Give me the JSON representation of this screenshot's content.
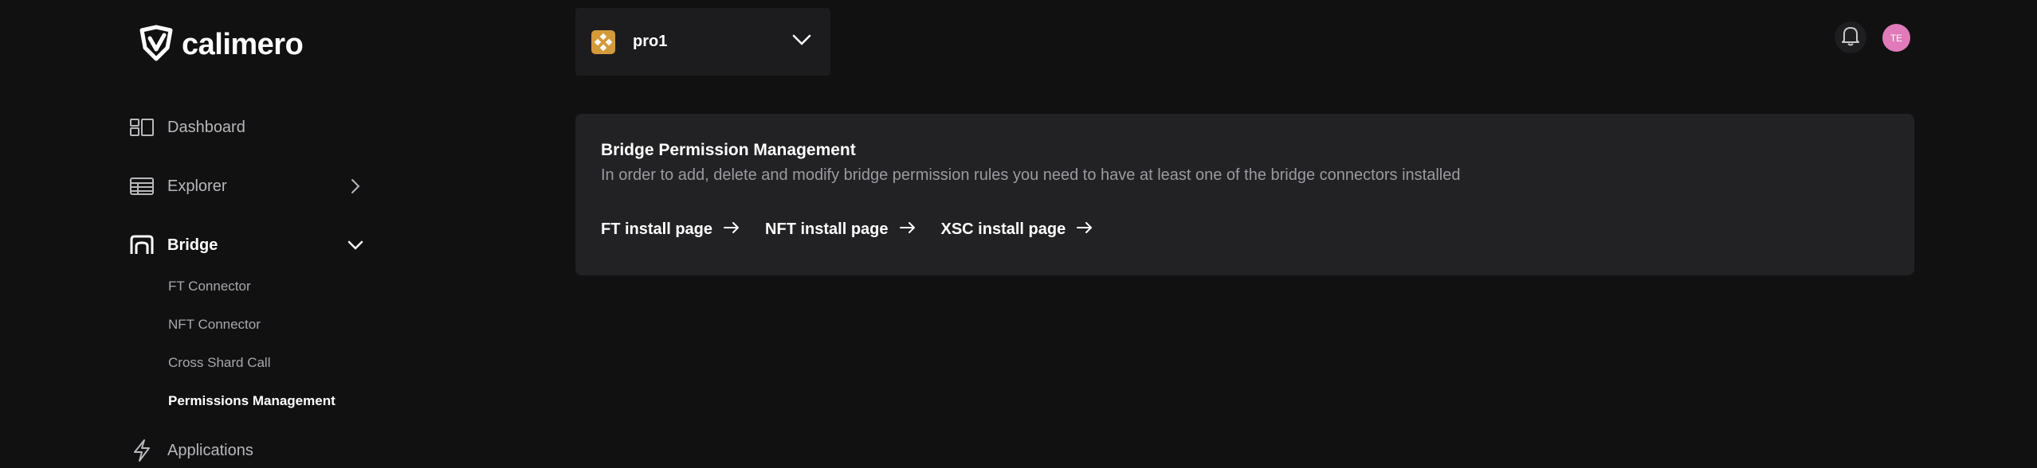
{
  "brand": {
    "name": "calimero"
  },
  "project": {
    "name": "pro1",
    "icon_color": "#d49a3a"
  },
  "header": {
    "avatar_initials": "TE",
    "avatar_color": "#e07ab8"
  },
  "sidebar": {
    "items": [
      {
        "label": "Dashboard",
        "icon": "dashboard-icon"
      },
      {
        "label": "Explorer",
        "icon": "table-icon",
        "chevron": "chevron-right-icon"
      },
      {
        "label": "Bridge",
        "icon": "bridge-icon",
        "chevron": "chevron-down-icon",
        "active": true
      },
      {
        "label": "Applications",
        "icon": "bolt-icon"
      }
    ],
    "bridge_sub": [
      {
        "label": "FT Connector"
      },
      {
        "label": "NFT Connector"
      },
      {
        "label": "Cross Shard Call"
      },
      {
        "label": "Permissions Management",
        "active": true
      }
    ]
  },
  "main": {
    "title": "Bridge Permission Management",
    "description": "In order to add, delete and modify bridge permission rules you need to have at least one of the bridge connectors installed",
    "links": [
      {
        "label": "FT install page",
        "icon": "arrow-right-icon"
      },
      {
        "label": "NFT install page",
        "icon": "arrow-right-icon"
      },
      {
        "label": "XSC install page",
        "icon": "arrow-right-icon"
      }
    ]
  },
  "colors": {
    "background": "#111112",
    "panel": "#222224",
    "accent_project": "#d49a3a",
    "avatar": "#e07ab8"
  }
}
